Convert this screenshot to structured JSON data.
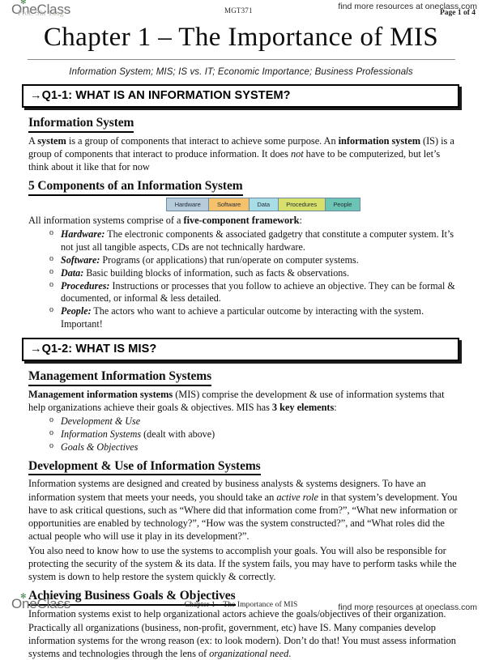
{
  "header": {
    "logo_text": "OneClass",
    "logo_sprout_icon": "leaf-sprout-icon",
    "professor_faded": "Prof. Shi Yang",
    "course_code": "MGT371",
    "watermark": "find more resources at oneclass.com",
    "page_label": "Page 1 of 4"
  },
  "title": "Chapter 1 – The Importance of MIS",
  "subtitle": "Information System; MIS; IS vs. IT; Economic Importance; Business Professionals",
  "sections": [
    {
      "question_banner": "→Q1-1: WHAT IS AN INFORMATION SYSTEM?",
      "heading_1": "Information System",
      "para_1_a": "A ",
      "para_1_b": "system",
      "para_1_c": " is a group of components that interact to achieve some purpose. An ",
      "para_1_d": "information system",
      "para_1_e": " (IS) is a group of components that interact to produce information. It does ",
      "para_1_f": "not",
      "para_1_g": " have to be computerized, but let’s think about it like that for now",
      "heading_2": "5 Components of an Information System",
      "components": [
        {
          "label": "Hardware",
          "color": "#b6ccdd"
        },
        {
          "label": "Software",
          "color": "#f5c26b"
        },
        {
          "label": "Data",
          "color": "#a9dde6"
        },
        {
          "label": "Procedures",
          "color": "#d7e06a"
        },
        {
          "label": "People",
          "color": "#6cc4b4"
        }
      ],
      "para_2_a": "All information systems comprise of a ",
      "para_2_b": "five-component framework",
      "para_2_c": ":",
      "bullets": [
        {
          "term": "Hardware:",
          "text": " The electronic components & associated gadgetry that constitute a computer system. It’s not just all tangible aspects, CDs are not technically hardware."
        },
        {
          "term": "Software:",
          "text": " Programs (or applications) that run/operate on computer systems."
        },
        {
          "term": "Data:",
          "text": " Basic building blocks of information, such as facts & observations."
        },
        {
          "term": "Procedures:",
          "text": " Instructions or processes that you follow to achieve an objective. They can be formal & documented, or informal & less detailed."
        },
        {
          "term": "People:",
          "text": " The actors who want to achieve a particular outcome by interacting with the system. Important!"
        }
      ]
    },
    {
      "question_banner": "→Q1-2: WHAT IS MIS?",
      "heading_1": "Management Information Systems",
      "para_1_a": "Management information systems",
      "para_1_b": " (MIS) comprise the development & use of information systems that help organizations achieve their goals & objectives. MIS has ",
      "para_1_c": "3 key elements",
      "para_1_d": ":",
      "bullets": [
        {
          "term": "Development & Use",
          "text": ""
        },
        {
          "term": "Information Systems",
          "text": " (dealt with above)"
        },
        {
          "term": "Goals & Objectives",
          "text": ""
        }
      ],
      "heading_2": "Development & Use of Information Systems",
      "para_2_a": "Information systems are designed and created by business analysts & systems designers. To have an information system that meets your needs, you should take an ",
      "para_2_b": "active role",
      "para_2_c": " in that system’s development. You have to ask critical questions, such as “Where did that information come from?”, “What new information or opportunities are enabled by technology?”, “How was the system constructed?”, and “What roles did the actual people who will use it play in its development?”.",
      "para_3": "You also need to know how to use the systems to accomplish your goals. You will also be responsible for protecting the security of the system & its data. If the system fails, you may have to perform tasks while the system is down to help restore the system quickly & correctly.",
      "heading_3": "Achieving Business Goals & Objectives",
      "para_4_a": "Information systems exist to help organizational actors achieve the goals/objectives of their organization. Practically all organizations (business, non-profit, government, etc) have IS. Many companies develop information systems for the wrong reason (ex: to look modern). Don’t do that! You must assess information systems and technologies through the lens of ",
      "para_4_b": "organizational need",
      "para_4_c": "."
    }
  ],
  "footer": {
    "logo_text": "OneClass",
    "logo_sprout_icon": "leaf-sprout-icon",
    "center_text": "Chapter 1 – The Importance of MIS",
    "watermark": "find more resources at oneclass.com"
  }
}
